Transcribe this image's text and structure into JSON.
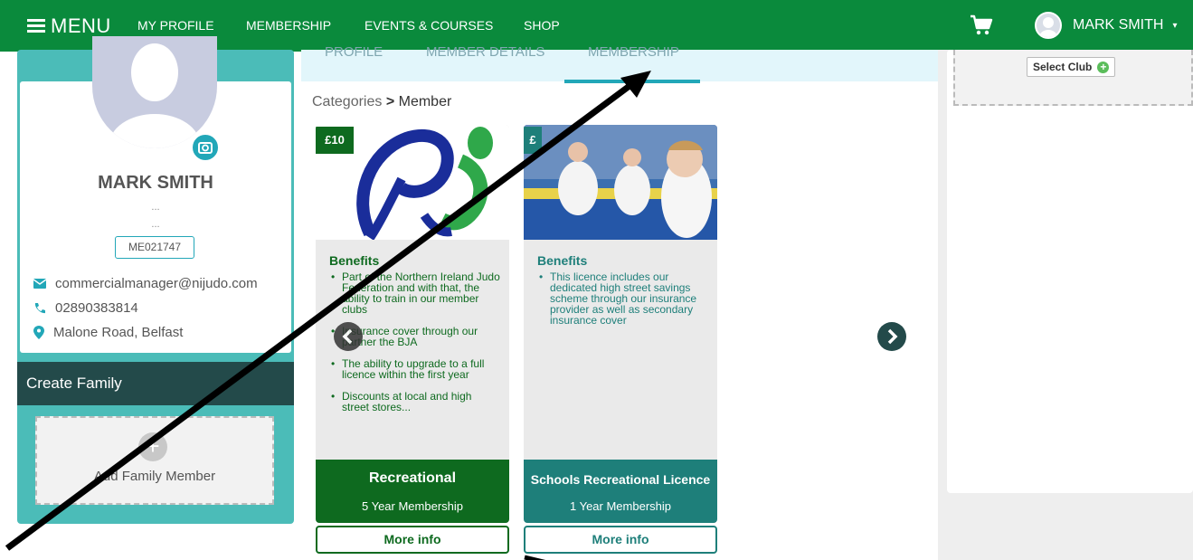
{
  "topbar": {
    "menu_label": "MENU",
    "nav": [
      "MY PROFILE",
      "MEMBERSHIP",
      "EVENTS & COURSES",
      "SHOP"
    ],
    "user_name": "MARK SMITH",
    "bg_color": "#0a8a3c"
  },
  "profile": {
    "name": "MARK SMITH",
    "dots1": "...",
    "dots2": "...",
    "member_id": "ME021747",
    "email": "commercialmanager@nijudo.com",
    "phone": "02890383814",
    "address": "Malone Road, Belfast"
  },
  "family": {
    "header": "Create Family",
    "add_label": "Add Family Member"
  },
  "tabs": [
    "PROFILE",
    "MEMBER DETAILS",
    "MEMBERSHIP"
  ],
  "breadcrumb": {
    "root": "Categories",
    "current": "Member"
  },
  "cards": [
    {
      "price": "£10",
      "benefits_title": "Benefits",
      "benefits": [
        "Part of the Northern Ireland Judo Federation and with that, the ability to train in our member clubs",
        "Insurance cover through our partner the BJA",
        "The ability to upgrade to a full licence within the first year",
        "Discounts at local and high street stores..."
      ],
      "title": "Recreational",
      "subtitle": "5 Year Membership",
      "more_info": "More info",
      "color": "#0e6a1f"
    },
    {
      "price": "£",
      "benefits_title": "Benefits",
      "benefits": [
        "This licence includes our dedicated high street savings scheme through our insurance provider as well as secondary insurance cover"
      ],
      "title": "Schools Recreational Licence",
      "subtitle": "1 Year Membership",
      "more_info": "More info",
      "color": "#1e7f7a"
    }
  ],
  "right": {
    "select_club": "Select Club"
  }
}
